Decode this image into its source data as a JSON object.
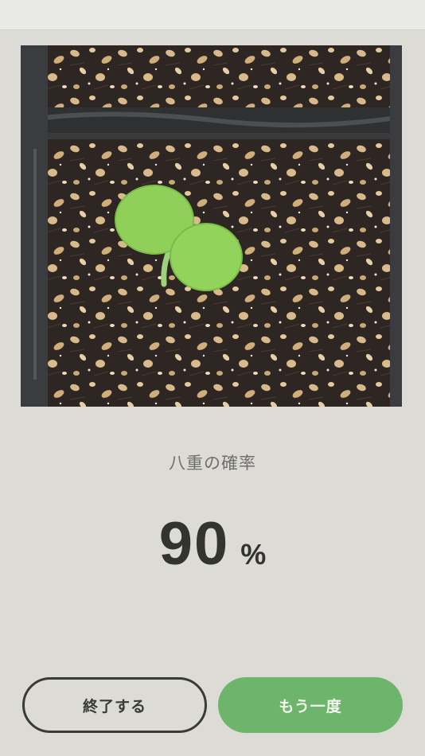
{
  "result": {
    "label": "八重の確率",
    "value": "90",
    "unit": "%"
  },
  "buttons": {
    "end_label": "終了する",
    "retry_label": "もう一度"
  },
  "colors": {
    "background": "#dcdbd6",
    "accent_green": "#6db56a",
    "text_dark": "#33332f",
    "text_muted": "#6f6f6c"
  },
  "photo": {
    "subject": "seedling-photo"
  }
}
